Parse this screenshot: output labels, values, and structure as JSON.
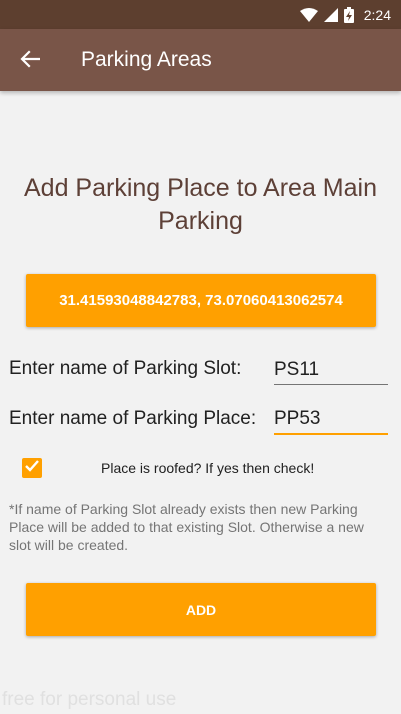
{
  "status_bar": {
    "time": "2:24",
    "icons": [
      "wifi-icon",
      "signal-icon",
      "battery-charging-icon"
    ]
  },
  "app_bar": {
    "title": "Parking Areas",
    "back_icon": "arrow-back-icon"
  },
  "main": {
    "heading": "Add Parking Place to Area Main Parking",
    "coordinates_button": "31.41593048842783, 73.07060413062574",
    "slot_label": "Enter  name of  Parking  Slot:",
    "slot_value": "PS11",
    "place_label": "Enter name of Parking Place:",
    "place_value": "PP53",
    "roofed_label": "Place is roofed? If yes then check!",
    "roofed_checked": true,
    "note": "*If name of Parking Slot already exists then new Parking Place will be added to that existing Slot. Otherwise a new slot will be created.",
    "add_button": "ADD"
  },
  "watermark": "free for personal use",
  "colors": {
    "status_bar": "#5d3f2f",
    "app_bar": "#795548",
    "accent": "#ffa000",
    "heading": "#5d4037",
    "background": "#f2f2f2"
  }
}
